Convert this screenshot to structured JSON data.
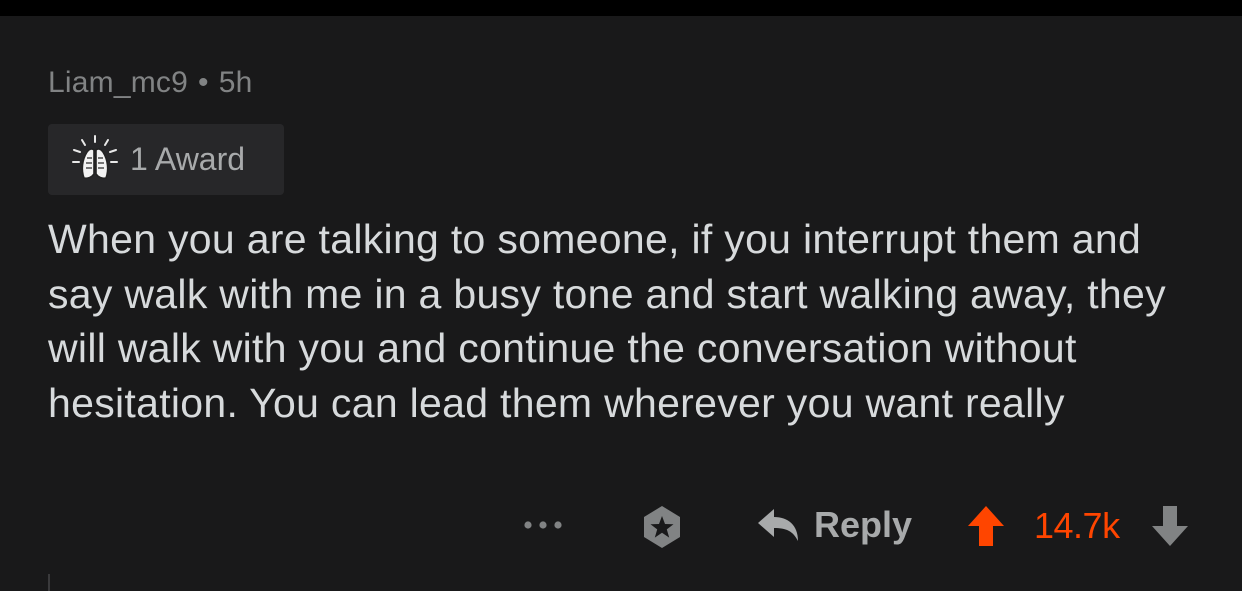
{
  "comment": {
    "author": "Liam_mc9",
    "separator": "•",
    "age": "5h",
    "awards": {
      "icon": "praying-hands-award-icon",
      "label": "1 Award"
    },
    "body": "When you are talking to someone, if you interrupt them and say walk with me in a busy tone and start walking away, they will walk with you and continue the conversation without hesitation. You can lead them wherever you want really"
  },
  "actions": {
    "more_icon": "ellipsis-icon",
    "give_award_icon": "award-star-icon",
    "reply_icon": "reply-arrow-icon",
    "reply_label": "Reply",
    "upvote_icon": "upvote-arrow-icon",
    "score": "14.7k",
    "downvote_icon": "downvote-arrow-icon"
  },
  "colors": {
    "background": "#19191a",
    "text": "#d7dadc",
    "muted": "#818384",
    "upvote_active": "#ff4500"
  }
}
